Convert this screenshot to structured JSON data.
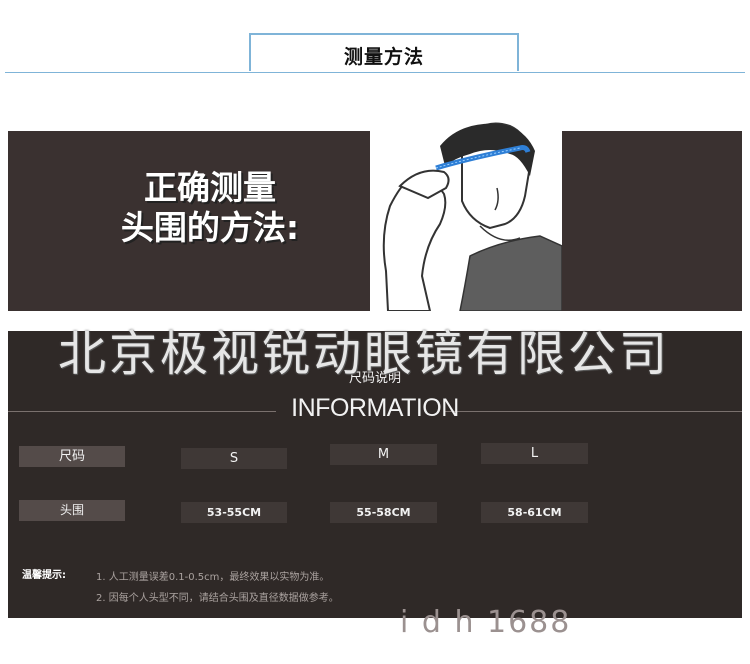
{
  "header": {
    "title": "测量方法"
  },
  "banner": {
    "line1": "正确测量",
    "line2": "头围的方法:"
  },
  "watermark": "北京极视锐动眼镜有限公司",
  "size_section": {
    "subtitle": "尺码说明",
    "title": "INFORMATION",
    "row1": {
      "label": "尺码",
      "values": [
        "S",
        "M",
        "L"
      ]
    },
    "row2": {
      "label": "头围",
      "values": [
        "53-55CM",
        "55-58CM",
        "58-61CM"
      ]
    }
  },
  "tips": {
    "label": "温馨提示:",
    "items": [
      "1. 人工测量误差0.1-0.5cm，最终效果以实物为准。",
      "2. 因每个人头型不同，请结合头围及直径数据做参考。"
    ]
  },
  "bottom_watermark": "i  d  h    1688",
  "colors": {
    "accent": "#7fb4d8",
    "panel": "#2f2927",
    "band": "#2e7fd6"
  }
}
